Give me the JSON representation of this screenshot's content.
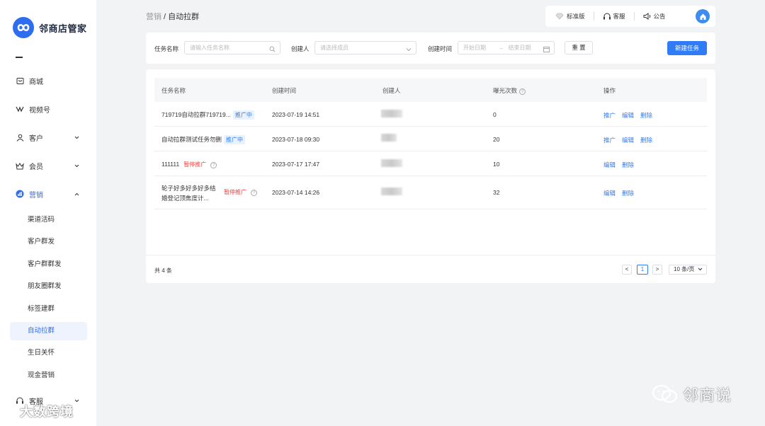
{
  "brand": {
    "name": "邻商店管家"
  },
  "sidebar": {
    "items": [
      {
        "label": "商城",
        "icon": "store-icon"
      },
      {
        "label": "视频号",
        "icon": "video-channel-icon"
      },
      {
        "label": "客户",
        "icon": "user-icon"
      },
      {
        "label": "会员",
        "icon": "crown-icon"
      },
      {
        "label": "营销",
        "icon": "marketing-icon"
      },
      {
        "label": "客服",
        "icon": "headset-icon"
      }
    ],
    "sub_items": [
      "渠道活码",
      "客户群发",
      "客户群群发",
      "朋友圈群发",
      "标签建群",
      "自动拉群",
      "生日关怀",
      "现金营销"
    ]
  },
  "breadcrumb": {
    "parent": "营销",
    "sep": " / ",
    "current": "自动拉群"
  },
  "topbar": {
    "edition": "标准版",
    "service": "客服",
    "notice": "公告"
  },
  "filters": {
    "task_name_label": "任务名称",
    "task_name_placeholder": "请输入任务名称",
    "creator_label": "创建人",
    "creator_placeholder": "请选择成员",
    "created_time_label": "创建时间",
    "start_date_placeholder": "开始日期",
    "end_date_placeholder": "结束日期",
    "range_arrow": "→",
    "reset_label": "重 置",
    "new_task_label": "新建任务"
  },
  "table": {
    "columns": [
      "任务名称",
      "创建时间",
      "创建人",
      "曝光次数",
      "操作"
    ],
    "rows": [
      {
        "name": "719719自动拉群719719...",
        "status": "推广中",
        "created": "2023-07-19 14:51",
        "exposure": "0",
        "actions": [
          "推广",
          "编辑",
          "删除"
        ]
      },
      {
        "name": "自动拉群测试任务勿删",
        "status": "推广中",
        "created": "2023-07-18 09:30",
        "exposure": "20",
        "actions": [
          "推广",
          "编辑",
          "删除"
        ]
      },
      {
        "name": "111111",
        "status": "暂停推广",
        "created": "2023-07-17 17:47",
        "exposure": "10",
        "actions": [
          "编辑",
          "删除"
        ]
      },
      {
        "name_line1": "轮子好多好多好多结",
        "name_line2": "婚登记顶焦度计...",
        "status": "暂停推广",
        "created": "2023-07-14 14:26",
        "exposure": "32",
        "actions": [
          "编辑",
          "删除"
        ]
      }
    ]
  },
  "pagination": {
    "total": "共 4 条",
    "current_page": "1",
    "prev": "<",
    "next": ">",
    "page_size": "10 条/页"
  },
  "watermarks": {
    "left": "大数跨境",
    "right": "邻商说"
  },
  "colors": {
    "primary": "#2f7cf6",
    "danger": "#f5403d",
    "background": "#f2f3f5"
  }
}
